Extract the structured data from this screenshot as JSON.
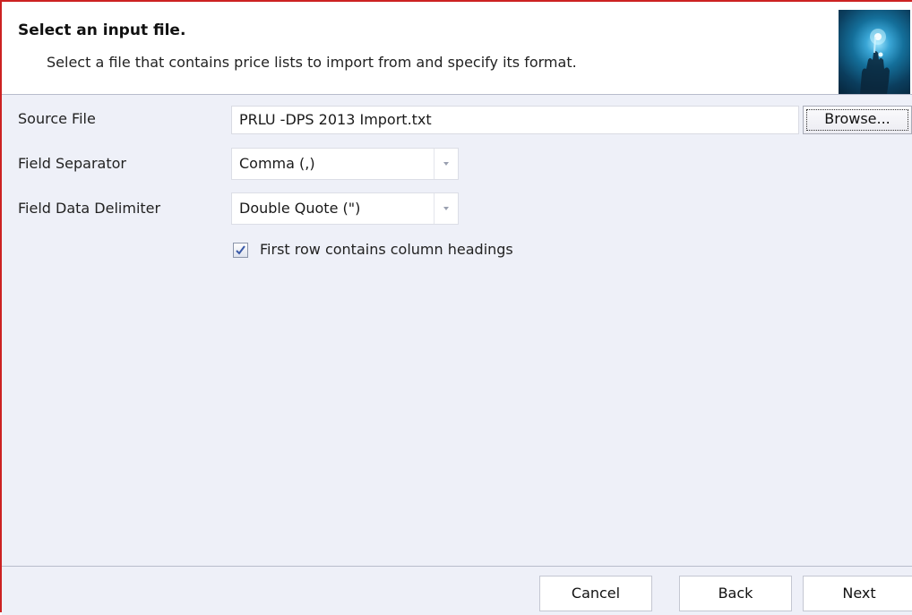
{
  "header": {
    "title": "Select an input file.",
    "subtitle": "Select a file that contains price lists to import from and specify its format.",
    "image_icon": "hand-touch-graphic"
  },
  "form": {
    "source_file": {
      "label": "Source File",
      "value": "PRLU -DPS 2013 Import.txt",
      "browse_label": "Browse..."
    },
    "field_separator": {
      "label": "Field Separator",
      "selected": "Comma (,)"
    },
    "field_data_delimiter": {
      "label": "Field Data Delimiter",
      "selected": "Double Quote (\")"
    },
    "first_row_headings": {
      "label": "First row contains column headings",
      "checked": true
    }
  },
  "footer": {
    "cancel_label": "Cancel",
    "back_label": "Back",
    "next_label": "Next"
  },
  "colors": {
    "window_border": "#cc2222",
    "content_background": "#eef0f8",
    "header_background": "#ffffff",
    "checkmark": "#3a5aa8"
  }
}
